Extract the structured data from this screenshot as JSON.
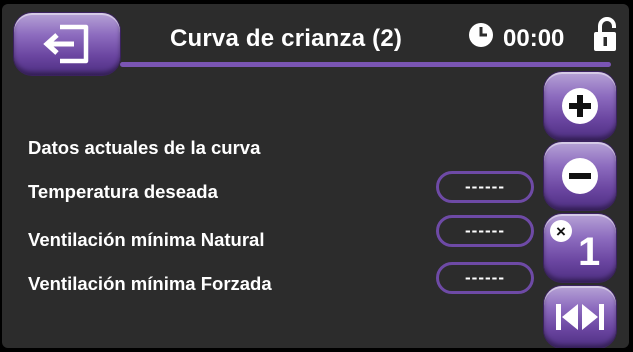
{
  "header": {
    "title": "Curva de crianza (2)",
    "time": "00:00"
  },
  "rows": [
    {
      "label": "Datos actuales de la curva"
    },
    {
      "label": "Temperatura deseada",
      "value": "------"
    },
    {
      "label": "Ventilación mínima Natural",
      "value": "------"
    },
    {
      "label": "Ventilación mínima Forzada",
      "value": "------"
    }
  ],
  "side_buttons": {
    "multiplier_symbol": "×",
    "multiplier_value": "1"
  },
  "icons": [
    "back-exit-icon",
    "clock-icon",
    "unlock-icon",
    "plus-icon",
    "minus-icon",
    "skip-prev-icon",
    "skip-next-icon"
  ],
  "colors": {
    "background": "#2c2c2c",
    "accent": "#7a55b3",
    "text": "#ffffff"
  }
}
